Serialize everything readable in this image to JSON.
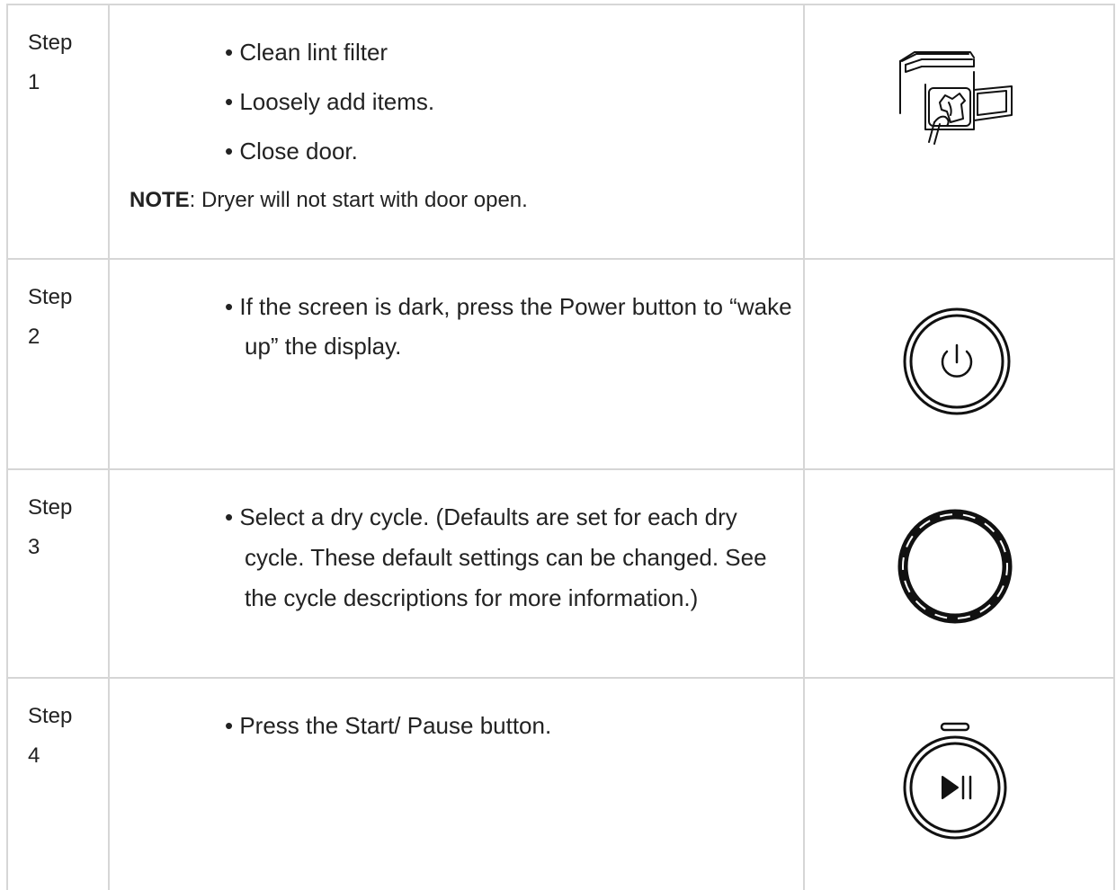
{
  "steps": [
    {
      "label_word": "Step",
      "label_num": "1",
      "bullets": [
        "Clean lint filter",
        "Loosely add items.",
        "Close door."
      ],
      "note_label": "NOTE",
      "note_text": ": Dryer will not start with door open.",
      "icon": "dryer-loading-illustration"
    },
    {
      "label_word": "Step",
      "label_num": "2",
      "bullets": [
        "If the screen is dark, press the Power button to “wake up” the display."
      ],
      "icon": "power-button-icon"
    },
    {
      "label_word": "Step",
      "label_num": "3",
      "bullets": [
        "Select a dry cycle. (Defaults are set for each dry cycle. These default settings can be changed. See the cycle descriptions for more information.)"
      ],
      "icon": "cycle-dial-icon"
    },
    {
      "label_word": "Step",
      "label_num": "4",
      "bullets": [
        "Press the Start/ Pause button."
      ],
      "icon": "start-pause-button-icon"
    }
  ],
  "bullet_char": "•",
  "colors": {
    "border": "#d6d6d6",
    "text": "#222222",
    "icon_stroke": "#111111"
  }
}
